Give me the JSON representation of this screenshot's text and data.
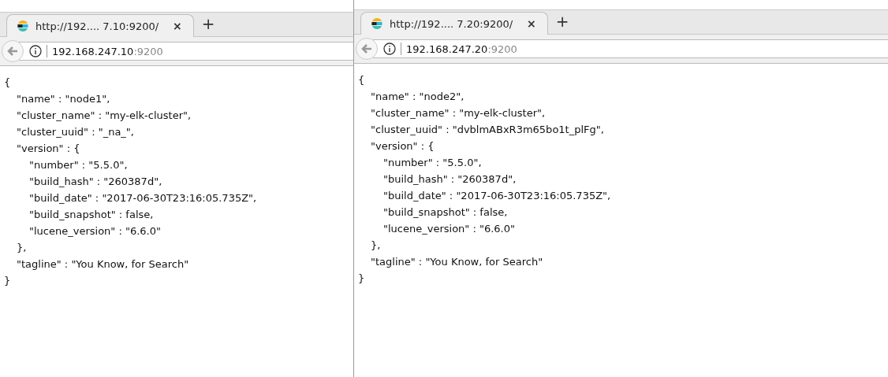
{
  "windows": [
    {
      "tabs": [
        {
          "title": "http://192.... 7.10:9200/",
          "selected": true,
          "close": "×"
        }
      ],
      "new_tab": "+",
      "address": {
        "host": "192.168.247.10",
        "port": ":9200"
      },
      "body": [
        {
          "text": "{",
          "children": [
            {
              "text": "\"name\" : \"node1\","
            },
            {
              "text": "\"cluster_name\" : \"my-elk-cluster\","
            },
            {
              "text": "\"cluster_uuid\" : \"_na_\","
            },
            {
              "text": "\"version\" : {",
              "children": [
                {
                  "text": "\"number\" : \"5.5.0\","
                },
                {
                  "text": "\"build_hash\" : \"260387d\","
                },
                {
                  "text": "\"build_date\" : \"2017-06-30T23:16:05.735Z\","
                },
                {
                  "text": "\"build_snapshot\" : false,"
                },
                {
                  "text": "\"lucene_version\" : \"6.6.0\""
                }
              ]
            },
            {
              "text": "},"
            },
            {
              "text": "\"tagline\" : \"You Know, for Search\""
            }
          ]
        },
        {
          "text": "}"
        }
      ]
    },
    {
      "tabs": [
        {
          "title": "http://192.... 7.20:9200/",
          "selected": true,
          "close": "×"
        }
      ],
      "new_tab": "+",
      "address": {
        "host": "192.168.247.20",
        "port": ":9200"
      },
      "body": [
        {
          "text": "{",
          "children": [
            {
              "text": "\"name\" : \"node2\","
            },
            {
              "text": "\"cluster_name\" : \"my-elk-cluster\","
            },
            {
              "text": "\"cluster_uuid\" : \"dvblmABxR3m65bo1t_plFg\","
            },
            {
              "text": "\"version\" : {",
              "children": [
                {
                  "text": "\"number\" : \"5.5.0\","
                },
                {
                  "text": "\"build_hash\" : \"260387d\","
                },
                {
                  "text": "\"build_date\" : \"2017-06-30T23:16:05.735Z\","
                },
                {
                  "text": "\"build_snapshot\" : false,"
                },
                {
                  "text": "\"lucene_version\" : \"6.6.0\""
                }
              ]
            },
            {
              "text": "},"
            },
            {
              "text": "\"tagline\" : \"You Know, for Search\""
            }
          ]
        },
        {
          "text": "}"
        }
      ]
    }
  ]
}
